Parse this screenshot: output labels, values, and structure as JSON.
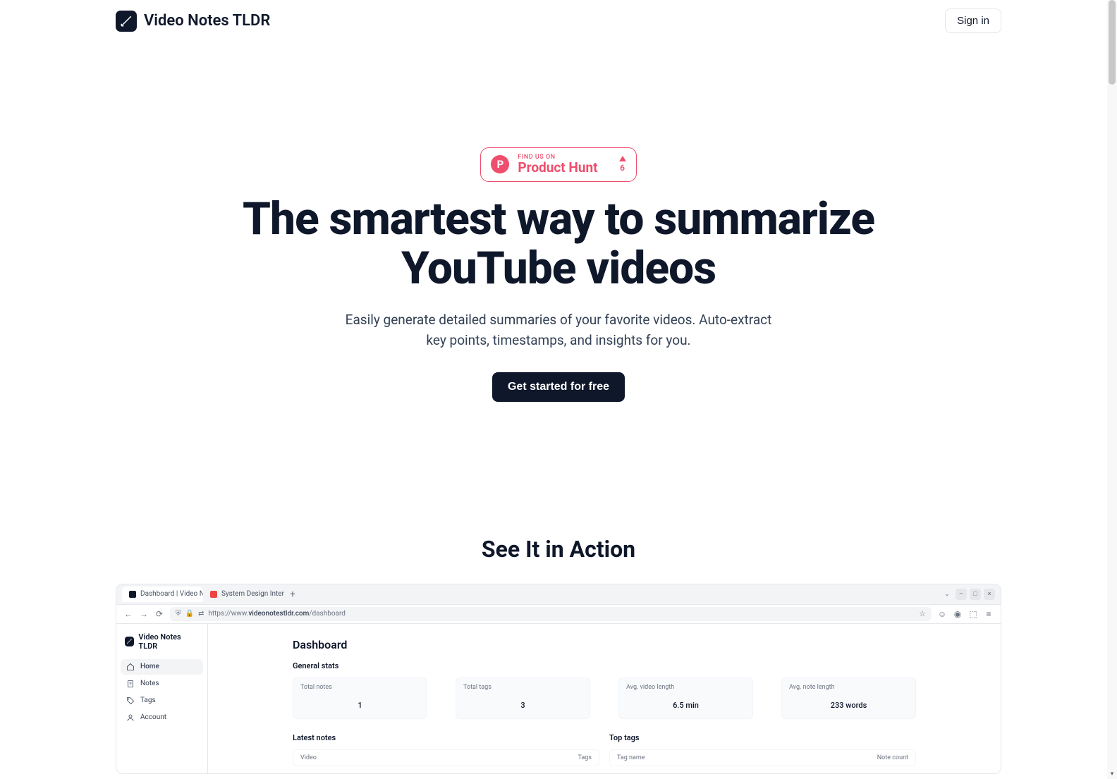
{
  "header": {
    "brand": "Video Notes TLDR",
    "signin": "Sign in"
  },
  "productHunt": {
    "letter": "P",
    "small": "FIND US ON",
    "big": "Product Hunt",
    "votes": "6"
  },
  "hero": {
    "title": "The smartest way to summarize YouTube videos",
    "subtitle": "Easily generate detailed summaries of your favorite videos. Auto-extract key points, timestamps, and insights for you.",
    "cta": "Get started for free"
  },
  "section": {
    "title": "See It in Action"
  },
  "browser": {
    "tabs": [
      {
        "label": "Dashboard | Video Note"
      },
      {
        "label": "System Design Interview"
      }
    ],
    "url_prefix": "https://www.",
    "url_domain": "videonotestldr.com",
    "url_path": "/dashboard"
  },
  "app": {
    "brand": "Video Notes TLDR",
    "nav": [
      {
        "label": "Home"
      },
      {
        "label": "Notes"
      },
      {
        "label": "Tags"
      },
      {
        "label": "Account"
      }
    ],
    "dashboard": {
      "title": "Dashboard",
      "generalStats": "General stats",
      "stats": [
        {
          "label": "Total notes",
          "value": "1"
        },
        {
          "label": "Total tags",
          "value": "3"
        },
        {
          "label": "Avg. video length",
          "value": "6.5 min"
        },
        {
          "label": "Avg. note length",
          "value": "233 words"
        }
      ],
      "latestNotes": {
        "title": "Latest notes",
        "col1": "Video",
        "col2": "Tags"
      },
      "topTags": {
        "title": "Top tags",
        "col1": "Tag name",
        "col2": "Note count"
      }
    }
  }
}
